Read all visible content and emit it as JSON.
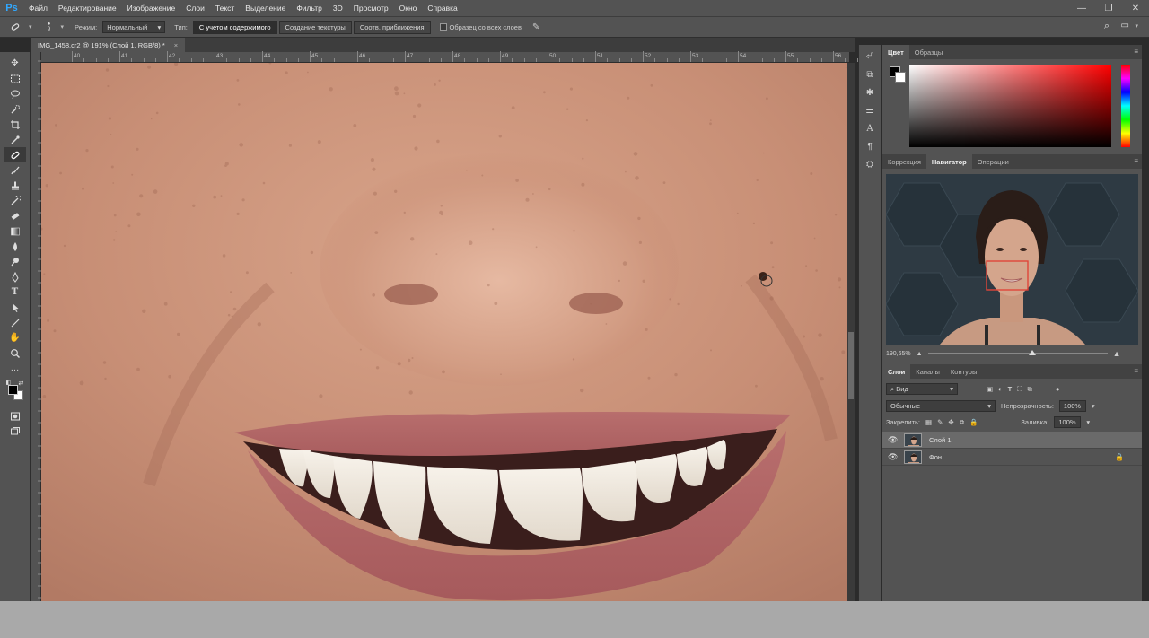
{
  "app": {
    "logo": "Ps",
    "menu": [
      "Файл",
      "Редактирование",
      "Изображение",
      "Слои",
      "Текст",
      "Выделение",
      "Фильтр",
      "3D",
      "Просмотр",
      "Окно",
      "Справка"
    ]
  },
  "options_bar": {
    "brush_size": "9",
    "mode_label": "Режим:",
    "mode_value": "Нормальный",
    "type_label": "Тип:",
    "type_buttons": [
      "С учетом содержимого",
      "Создание текстуры",
      "Соотв. приближения"
    ],
    "active_type_index": 0,
    "sample_all_layers": "Образец со всех слоев"
  },
  "document": {
    "tab_title": "IMG_1458.cr2 @ 191% (Слой 1, RGB/8) *",
    "close_glyph": "×"
  },
  "rulers": {
    "h_ticks": [
      "40",
      "41",
      "42",
      "43",
      "44",
      "45",
      "46",
      "47",
      "48",
      "49",
      "50",
      "51",
      "52",
      "53",
      "54",
      "55",
      "56"
    ]
  },
  "color_panel": {
    "tabs": [
      "Цвет",
      "Образцы"
    ],
    "foreground": "#000000",
    "background": "#ffffff"
  },
  "navigator_panel": {
    "tabs": [
      "Коррекция",
      "Навигатор",
      "Операции"
    ],
    "active_tab_index": 1,
    "zoom": "190,65%"
  },
  "layers_panel": {
    "tabs": [
      "Слои",
      "Каналы",
      "Контуры"
    ],
    "filter_label": "Вид",
    "blend_mode": "Обычные",
    "opacity_label": "Непрозрачность:",
    "opacity_value": "100%",
    "lock_label": "Закрепить:",
    "fill_label": "Заливка:",
    "fill_value": "100%",
    "layers": [
      {
        "name": "Слой 1",
        "selected": true,
        "locked": false
      },
      {
        "name": "Фон",
        "selected": false,
        "locked": true
      }
    ]
  },
  "colors": {
    "ui_dark": "#535353",
    "ui_darker": "#3e3e3e",
    "ps_blue": "#31a8ff",
    "selection_red": "#e0453a"
  }
}
